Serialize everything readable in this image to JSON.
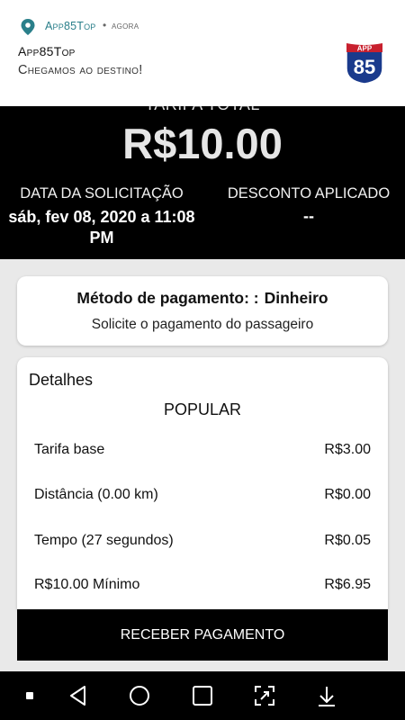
{
  "notification": {
    "app_name": "App85Top",
    "separator": "•",
    "time": "agora",
    "title": "App85Top",
    "message": "Chegamos ao destino!",
    "logo_text_top": "APP",
    "logo_text_main": "85"
  },
  "header": {
    "tarifa_label": "TARIFA TOTAL",
    "tarifa_value": "R$10.00",
    "date_label": "DATA DA SOLICITAÇÃO",
    "date_value": "sáb, fev 08, 2020 a 11:08 PM",
    "discount_label": "DESCONTO APLICADO",
    "discount_value": "--"
  },
  "payment": {
    "method_label": "Método de pagamento: :",
    "method_value": "Dinheiro",
    "instruction": "Solicite o pagamento do passageiro"
  },
  "details": {
    "title": "Detalhes",
    "category": "POPULAR",
    "rows": [
      {
        "label": "Tarifa base",
        "value": "R$3.00"
      },
      {
        "label": "Distância (0.00 km)",
        "value": "R$0.00"
      },
      {
        "label": "Tempo (27 segundos)",
        "value": "R$0.05"
      },
      {
        "label": "R$10.00 Mínimo",
        "value": "R$6.95"
      }
    ]
  },
  "action": {
    "receive_label": "RECEBER PAGAMENTO"
  },
  "navbar": {
    "icons": [
      "menu-dot-icon",
      "back-icon",
      "home-icon",
      "recents-icon",
      "screenshot-icon",
      "notification-pull-icon"
    ]
  },
  "colors": {
    "accent": "#2a7f8a",
    "header_bg": "#000000",
    "page_bg": "#e9e9e9",
    "logo_blue": "#1a3a8c",
    "logo_red": "#c8202e"
  }
}
